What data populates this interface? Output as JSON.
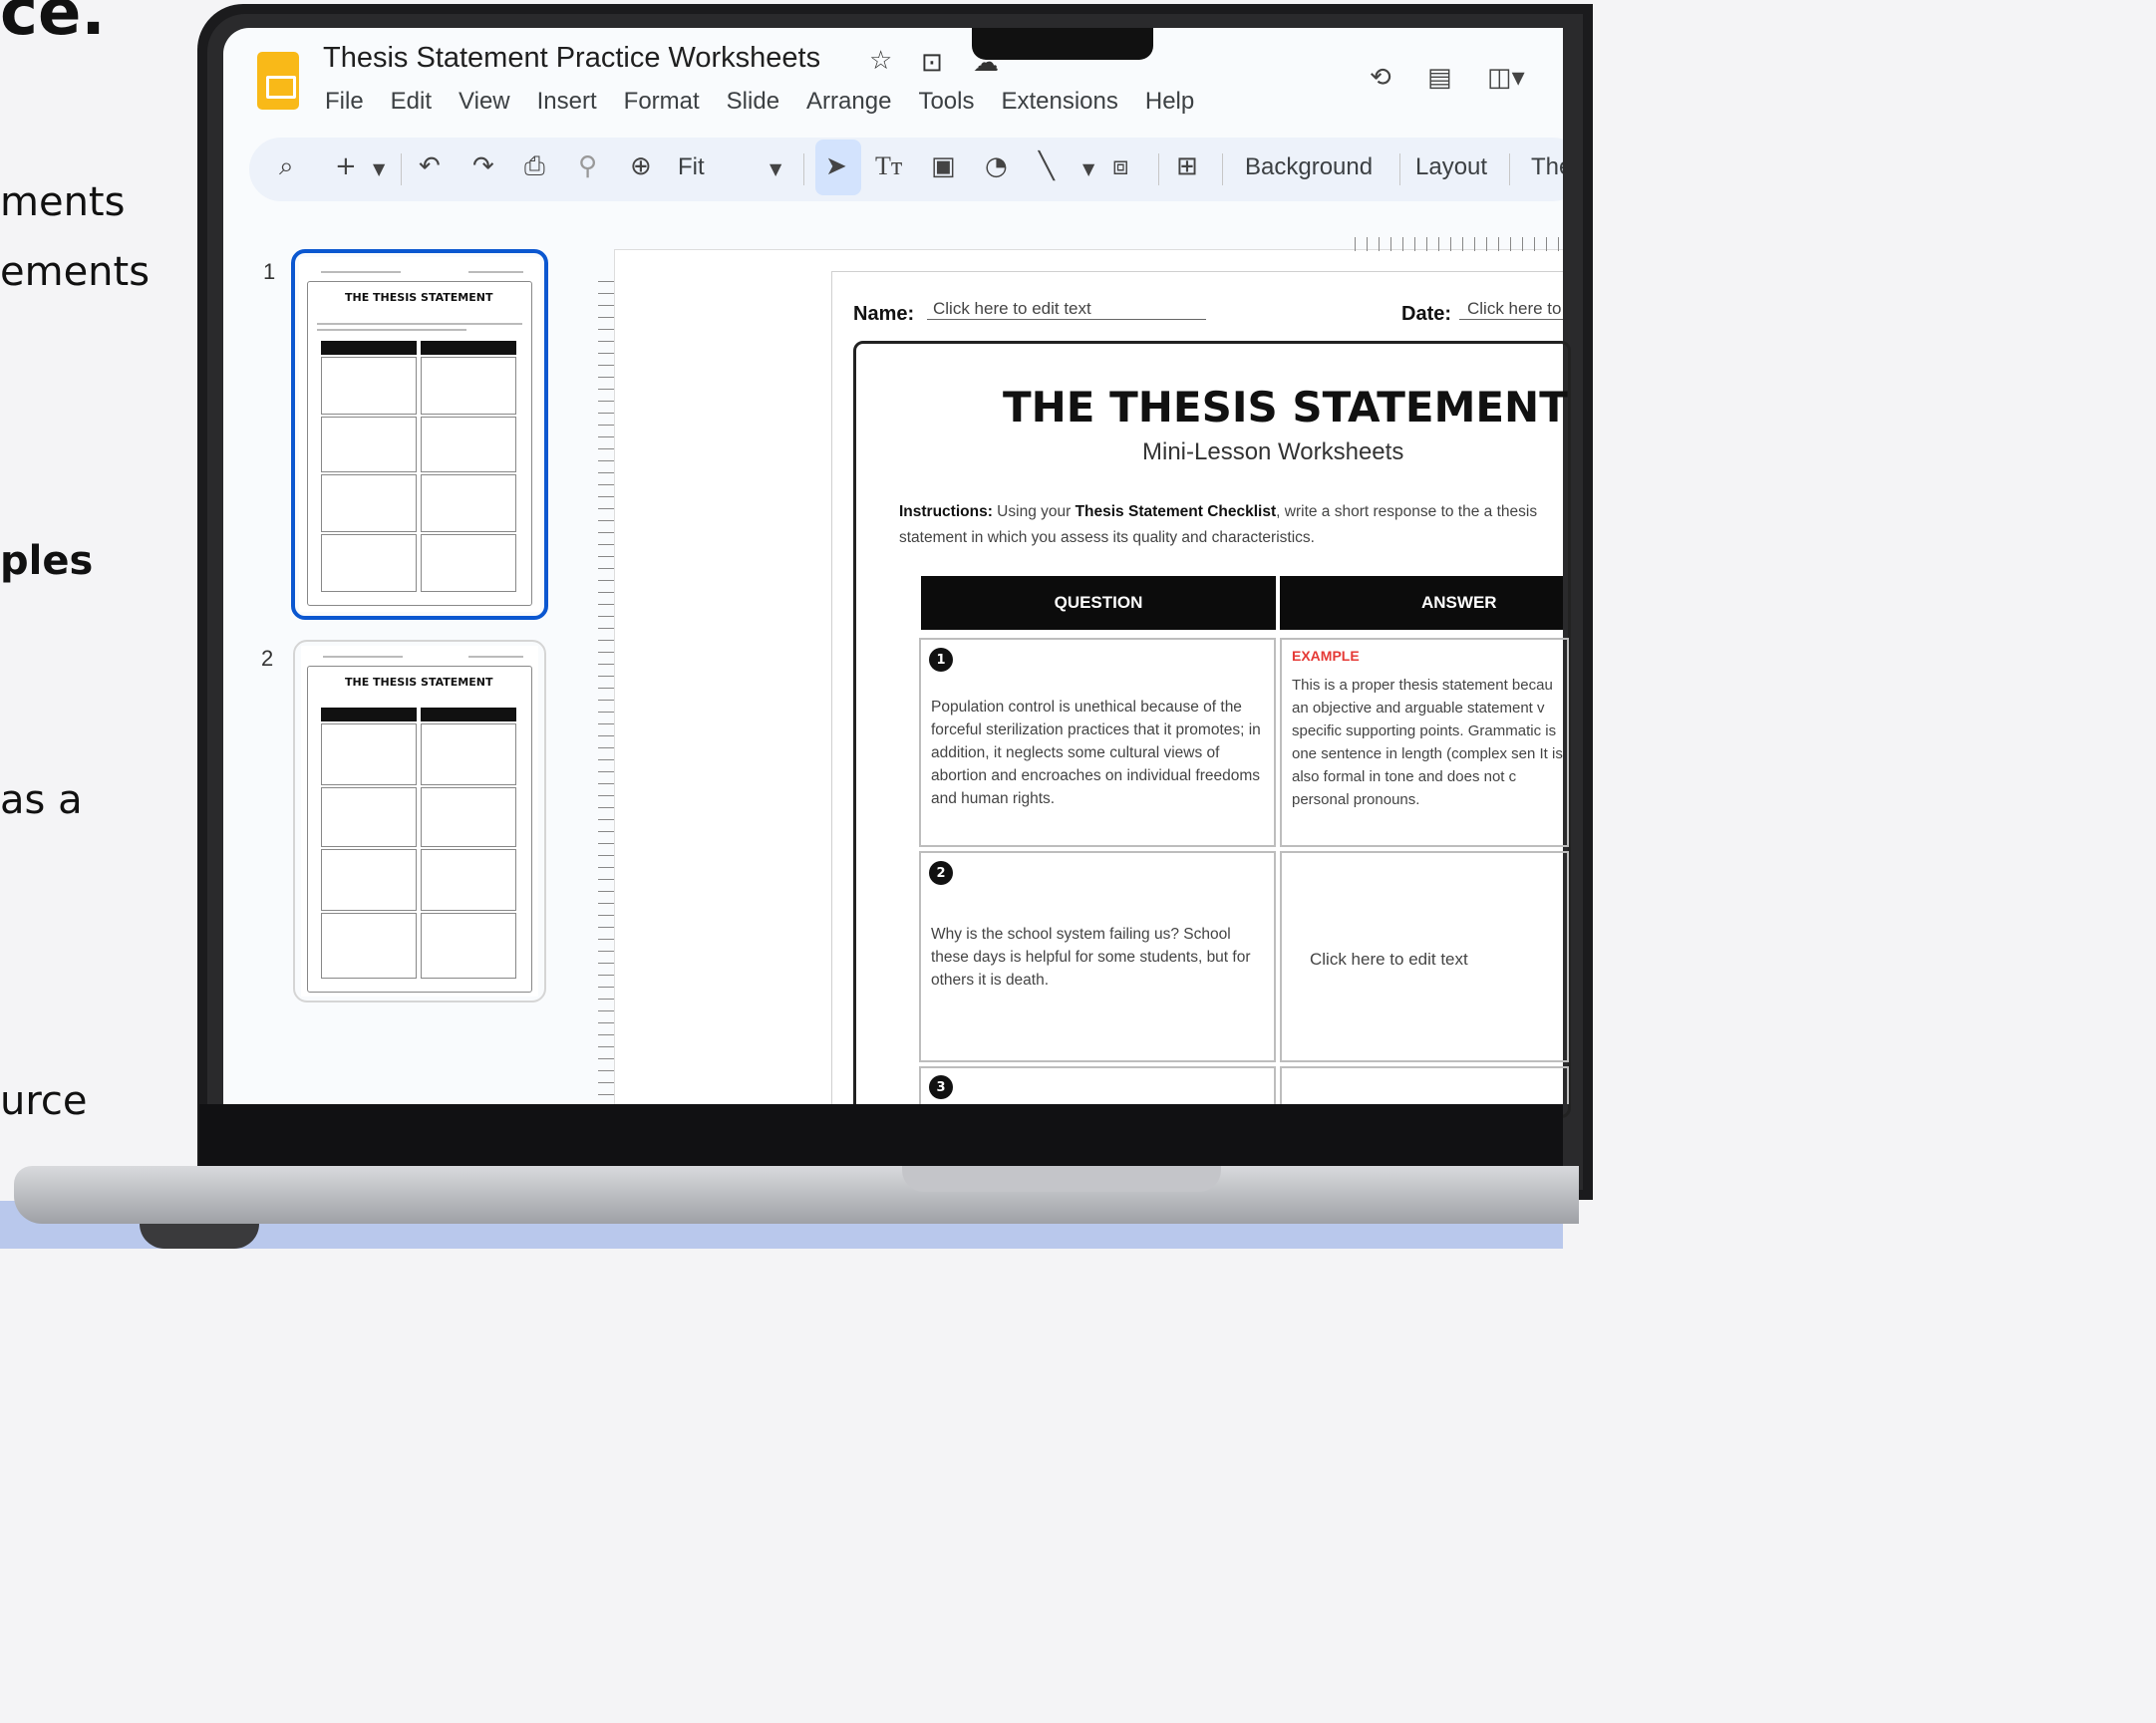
{
  "left_text": {
    "frag1": "ce.",
    "frag2": "ments",
    "frag3": "ements",
    "frag4": "ples",
    "frag5": "as a",
    "frag6": "urce"
  },
  "app": {
    "title": "Thesis Statement Practice Worksheets",
    "menu": [
      "File",
      "Edit",
      "View",
      "Insert",
      "Format",
      "Slide",
      "Arrange",
      "Tools",
      "Extensions",
      "Help"
    ]
  },
  "toolbar": {
    "zoom_label": "Fit",
    "background_label": "Background",
    "layout_label": "Layout",
    "theme_label": "The"
  },
  "slides_panel": {
    "slides": [
      {
        "number": "1",
        "title": "THE THESIS STATEMENT"
      },
      {
        "number": "2",
        "title": "THE THESIS STATEMENT"
      }
    ]
  },
  "slide": {
    "name_label": "Name:",
    "name_value": "Click here to edit text",
    "date_label": "Date:",
    "date_value": "Click here to",
    "title": "THE THESIS STATEMENT",
    "subtitle": "Mini-Lesson Worksheets",
    "instr_lead": "Instructions:",
    "instr_a": " Using your ",
    "instr_checklist": "Thesis Statement Checklist",
    "instr_b": ", write a short response to the a thesis statement in which you assess its quality and characteristics.",
    "col_question": "QUESTION",
    "col_answer": "ANSWER",
    "rows": [
      {
        "number": "1",
        "question": "Population control is unethical because of the forceful sterilization practices that it promotes; in addition, it neglects some cultural views of abortion and encroaches on individual freedoms and human rights.",
        "answer_label": "EXAMPLE",
        "answer": "This is a proper thesis statement becau an objective and arguable statement v specific supporting points. Grammatic is one sentence in length (complex sen It is also formal in tone and does not c personal pronouns."
      },
      {
        "number": "2",
        "question": "Why is the school system failing us? School these days is helpful for some students, but for others it is death.",
        "answer": "Click here to edit text"
      },
      {
        "number": "3"
      }
    ]
  },
  "colors": {
    "logo": "#f9b918",
    "selected_outline": "#0b57d0",
    "example_red": "#e53935",
    "floor": "#b9c8ec"
  }
}
